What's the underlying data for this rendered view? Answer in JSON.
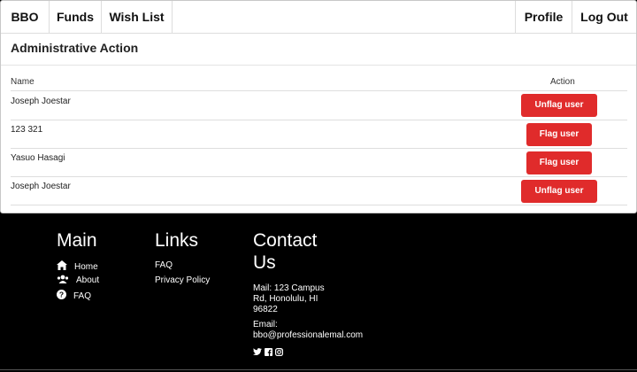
{
  "nav": {
    "brand": "BBO",
    "funds": "Funds",
    "wishlist": "Wish List",
    "profile": "Profile",
    "logout": "Log Out"
  },
  "card": {
    "title": "Administrative Action",
    "col_name": "Name",
    "col_action": "Action",
    "rows": [
      {
        "name": "Joseph Joestar",
        "action": "Unflag user"
      },
      {
        "name": "123 321",
        "action": "Flag user"
      },
      {
        "name": "Yasuo Hasagi",
        "action": "Flag user"
      },
      {
        "name": "Joseph Joestar",
        "action": "Unflag user"
      }
    ]
  },
  "footer": {
    "main_title": "Main",
    "main_links": [
      {
        "label": "Home",
        "icon": "home-icon"
      },
      {
        "label": "About",
        "icon": "users-icon"
      },
      {
        "label": "FAQ",
        "icon": "question-circle-icon"
      }
    ],
    "links_title": "Links",
    "links": [
      "FAQ",
      "Privacy Policy"
    ],
    "contact_title_1": "Contact",
    "contact_title_2": "Us",
    "mail_1": "Mail: 123 Campus",
    "mail_2": "Rd, Honolulu, HI",
    "mail_3": "96822",
    "email_label": "Email:",
    "email_value": "bbo@professionalemal.com",
    "social_icons": [
      "twitter-icon",
      "facebook-icon",
      "instagram-icon"
    ]
  },
  "colors": {
    "button_red": "#e02b2b",
    "footer_bg": "#000000"
  }
}
